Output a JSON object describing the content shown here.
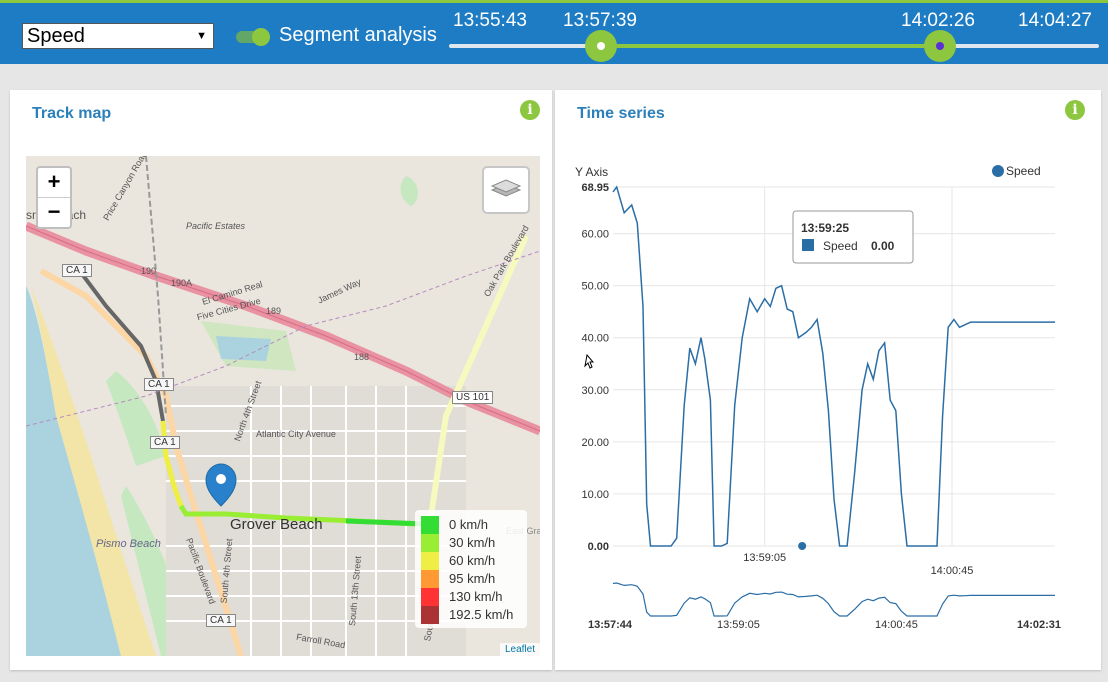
{
  "topbar": {
    "metric_select": "Speed",
    "segment_label": "Segment analysis",
    "times": [
      "13:55:43",
      "13:57:39",
      "14:02:26",
      "14:04:27"
    ]
  },
  "map_panel": {
    "title": "Track map",
    "info_icon": "i",
    "zoom_in": "+",
    "zoom_out": "−",
    "attribution": "Leaflet",
    "city_label": "Grover Beach",
    "labels": [
      "Pismo Beach",
      "Pacific Estates",
      "El Camino Real",
      "Five Cities Drive",
      "James Way",
      "Oak Park Boulevard",
      "Atlantic City Avenue",
      "North 4th Street",
      "South 4th Street",
      "South 13th Street",
      "Pacific Boulevard",
      "Farroll Road",
      "Price Canyon Road",
      "East Gran",
      "South Oak P",
      "smo Beach"
    ],
    "shields": [
      "CA 1",
      "190",
      "190A",
      "189",
      "188",
      "US 101"
    ],
    "legend": [
      {
        "label": "0 km/h",
        "color": "#33dd33"
      },
      {
        "label": "30 km/h",
        "color": "#99ee33"
      },
      {
        "label": "60 km/h",
        "color": "#eeee44"
      },
      {
        "label": "95 km/h",
        "color": "#ff9933"
      },
      {
        "label": "130 km/h",
        "color": "#ff3333"
      },
      {
        "label": "192.5 km/h",
        "color": "#aa3333"
      }
    ]
  },
  "ts_panel": {
    "title": "Time series",
    "info_icon": "i",
    "y_axis_title": "Y Axis",
    "legend_series": "Speed",
    "tooltip": {
      "time": "13:59:25",
      "series": "Speed",
      "value": "0.00"
    },
    "navigator_labels": [
      "13:57:44",
      "13:59:05",
      "14:00:45",
      "14:02:31"
    ]
  },
  "chart_data": {
    "type": "line",
    "series": [
      {
        "name": "Speed",
        "color": "#2b6ea6"
      }
    ],
    "y_ticks": [
      "0.00",
      "10.00",
      "20.00",
      "30.00",
      "40.00",
      "50.00",
      "60.00",
      "68.95"
    ],
    "x_ticks": [
      "13:59:05",
      "14:00:45",
      "14:02:26"
    ],
    "ylim": [
      0,
      68.95
    ],
    "x": [
      "13:57:44",
      "13:57:46",
      "13:57:50",
      "13:57:54",
      "13:57:57",
      "13:58:00",
      "13:58:02",
      "13:58:04",
      "13:58:08",
      "13:58:13",
      "13:58:15",
      "13:58:18",
      "13:58:22",
      "13:58:25",
      "13:58:28",
      "13:58:31",
      "13:58:33",
      "13:58:36",
      "13:58:38",
      "13:58:42",
      "13:58:45",
      "13:58:49",
      "13:58:53",
      "13:58:57",
      "13:59:01",
      "13:59:05",
      "13:59:08",
      "13:59:11",
      "13:59:14",
      "13:59:17",
      "13:59:20",
      "13:59:23",
      "13:59:27",
      "13:59:30",
      "13:59:33",
      "13:59:36",
      "13:59:39",
      "13:59:42",
      "13:59:45",
      "13:59:49",
      "13:59:53",
      "13:59:57",
      "14:00:00",
      "14:00:03",
      "14:00:06",
      "14:00:09",
      "14:00:12",
      "14:00:15",
      "14:00:18",
      "14:00:21",
      "14:00:25",
      "14:00:28",
      "14:00:32",
      "14:00:35",
      "14:00:37",
      "14:00:40",
      "14:00:43",
      "14:00:46",
      "14:00:49",
      "14:00:52",
      "14:00:55",
      "14:00:58",
      "14:01:01",
      "14:01:05",
      "14:01:09",
      "14:01:13",
      "14:01:17",
      "14:01:21",
      "14:01:25",
      "14:01:27",
      "14:01:30",
      "14:01:33",
      "14:01:37",
      "14:01:40"
    ],
    "values": [
      68,
      68.95,
      64,
      65.5,
      62,
      46,
      8,
      0,
      0,
      0,
      0,
      1.5,
      27,
      38,
      35,
      40,
      36,
      28,
      0,
      0,
      0.5,
      27,
      40,
      47.5,
      45,
      47.5,
      46,
      49.5,
      50,
      45.5,
      45,
      40,
      41,
      42,
      43.5,
      37,
      26,
      9,
      0,
      0,
      14,
      30,
      35,
      32,
      37.5,
      39,
      28,
      26,
      10,
      0,
      0,
      0,
      0,
      0,
      0,
      25,
      42,
      43.5,
      42,
      42.5,
      43,
      43,
      43,
      43,
      43,
      43,
      43,
      43,
      43,
      43,
      43,
      43,
      43,
      43
    ]
  }
}
